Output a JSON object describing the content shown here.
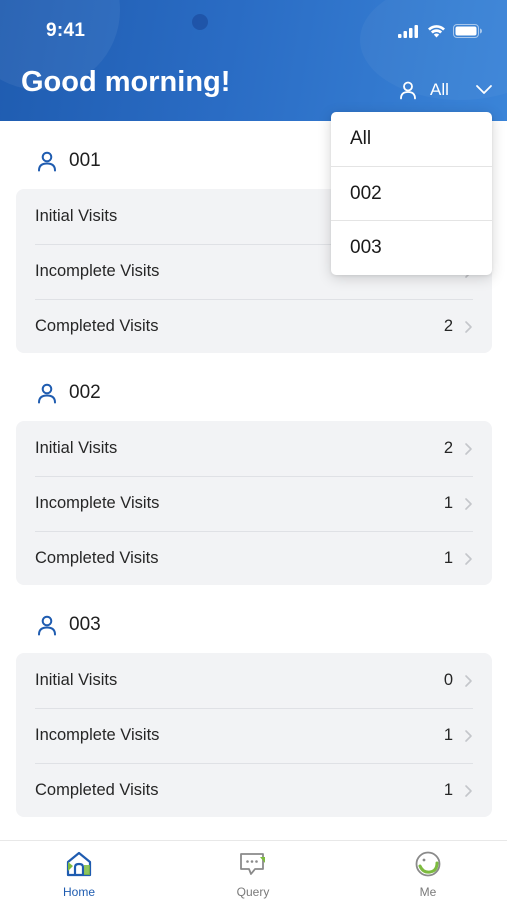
{
  "status_bar": {
    "time": "9:41"
  },
  "header": {
    "greeting": "Good morning!",
    "filter_label": "All"
  },
  "dropdown": {
    "options": [
      "All",
      "002",
      "003"
    ]
  },
  "groups": [
    {
      "name": "001",
      "rows": [
        {
          "label": "Initial Visits",
          "count": ""
        },
        {
          "label": "Incomplete Visits",
          "count": ""
        },
        {
          "label": "Completed Visits",
          "count": "2"
        }
      ]
    },
    {
      "name": "002",
      "rows": [
        {
          "label": "Initial Visits",
          "count": "2"
        },
        {
          "label": "Incomplete Visits",
          "count": "1"
        },
        {
          "label": "Completed Visits",
          "count": "1"
        }
      ]
    },
    {
      "name": "003",
      "rows": [
        {
          "label": "Initial Visits",
          "count": "0"
        },
        {
          "label": "Incomplete Visits",
          "count": "1"
        },
        {
          "label": "Completed Visits",
          "count": "1"
        }
      ]
    }
  ],
  "tabbar": {
    "tabs": [
      {
        "label": "Home",
        "icon": "home-icon",
        "active": true
      },
      {
        "label": "Query",
        "icon": "query-icon",
        "active": false
      },
      {
        "label": "Me",
        "icon": "me-icon",
        "active": false
      }
    ]
  },
  "colors": {
    "brand": "#1f5cb0",
    "accent_green": "#7dbb3f",
    "card_bg": "#f2f3f5"
  }
}
